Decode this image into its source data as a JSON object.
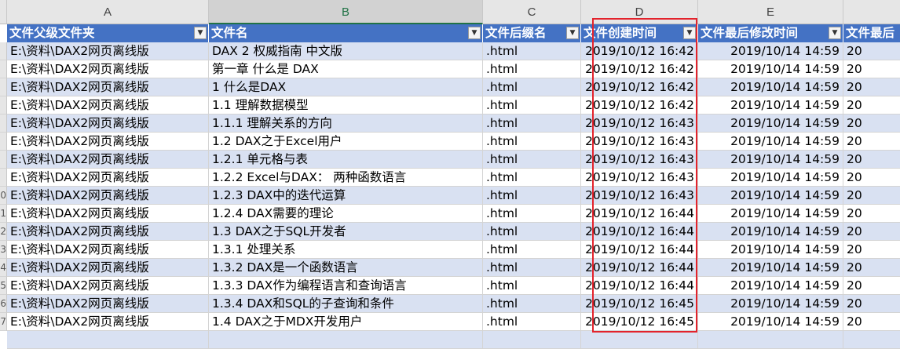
{
  "columns": [
    "A",
    "B",
    "C",
    "D",
    "E"
  ],
  "headers": [
    "文件父级文件夹",
    "文件名",
    "文件后缀名",
    "文件创建时间",
    "文件最后修改时间",
    "文件最后"
  ],
  "filter_icon": "chevron-down-icon",
  "rows": [
    {
      "n": "",
      "a": "E:\\资料\\DAX2网页离线版",
      "b": "DAX 2 权威指南 中文版",
      "c": ".html",
      "d": "2019/10/12 16:42",
      "e": "2019/10/14 14:59",
      "f": "20"
    },
    {
      "n": "",
      "a": "E:\\资料\\DAX2网页离线版",
      "b": "第一章 什么是 DAX",
      "c": ".html",
      "d": "2019/10/12 16:42",
      "e": "2019/10/14 14:59",
      "f": "20"
    },
    {
      "n": "",
      "a": "E:\\资料\\DAX2网页离线版",
      "b": "1 什么是DAX",
      "c": ".html",
      "d": "2019/10/12 16:42",
      "e": "2019/10/14 14:59",
      "f": "20"
    },
    {
      "n": "",
      "a": "E:\\资料\\DAX2网页离线版",
      "b": "1.1 理解数据模型",
      "c": ".html",
      "d": "2019/10/12 16:42",
      "e": "2019/10/14 14:59",
      "f": "20"
    },
    {
      "n": "",
      "a": "E:\\资料\\DAX2网页离线版",
      "b": "1.1.1 理解关系的方向",
      "c": ".html",
      "d": "2019/10/12 16:43",
      "e": "2019/10/14 14:59",
      "f": "20"
    },
    {
      "n": "",
      "a": "E:\\资料\\DAX2网页离线版",
      "b": "1.2 DAX之于Excel用户",
      "c": ".html",
      "d": "2019/10/12 16:43",
      "e": "2019/10/14 14:59",
      "f": "20"
    },
    {
      "n": "",
      "a": "E:\\资料\\DAX2网页离线版",
      "b": "1.2.1 单元格与表",
      "c": ".html",
      "d": "2019/10/12 16:43",
      "e": "2019/10/14 14:59",
      "f": "20"
    },
    {
      "n": "",
      "a": "E:\\资料\\DAX2网页离线版",
      "b": "1.2.2 Excel与DAX： 两种函数语言",
      "c": ".html",
      "d": "2019/10/12 16:43",
      "e": "2019/10/14 14:59",
      "f": "20"
    },
    {
      "n": "0",
      "a": "E:\\资料\\DAX2网页离线版",
      "b": "1.2.3 DAX中的迭代运算",
      "c": ".html",
      "d": "2019/10/12 16:43",
      "e": "2019/10/14 14:59",
      "f": "20"
    },
    {
      "n": "1",
      "a": "E:\\资料\\DAX2网页离线版",
      "b": "1.2.4 DAX需要的理论",
      "c": ".html",
      "d": "2019/10/12 16:44",
      "e": "2019/10/14 14:59",
      "f": "20"
    },
    {
      "n": "2",
      "a": "E:\\资料\\DAX2网页离线版",
      "b": "1.3 DAX之于SQL开发者",
      "c": ".html",
      "d": "2019/10/12 16:44",
      "e": "2019/10/14 14:59",
      "f": "20"
    },
    {
      "n": "3",
      "a": "E:\\资料\\DAX2网页离线版",
      "b": "1.3.1 处理关系",
      "c": ".html",
      "d": "2019/10/12 16:44",
      "e": "2019/10/14 14:59",
      "f": "20"
    },
    {
      "n": "4",
      "a": "E:\\资料\\DAX2网页离线版",
      "b": "1.3.2 DAX是一个函数语言",
      "c": ".html",
      "d": "2019/10/12 16:44",
      "e": "2019/10/14 14:59",
      "f": "20"
    },
    {
      "n": "5",
      "a": "E:\\资料\\DAX2网页离线版",
      "b": "1.3.3 DAX作为编程语言和查询语言",
      "c": ".html",
      "d": "2019/10/12 16:44",
      "e": "2019/10/14 14:59",
      "f": "20"
    },
    {
      "n": "6",
      "a": "E:\\资料\\DAX2网页离线版",
      "b": "1.3.4 DAX和SQL的子查询和条件",
      "c": ".html",
      "d": "2019/10/12 16:45",
      "e": "2019/10/14 14:59",
      "f": "20"
    },
    {
      "n": "7",
      "a": "E:\\资料\\DAX2网页离线版",
      "b": "1.4 DAX之于MDX开发用户",
      "c": ".html",
      "d": "2019/10/12 16:45",
      "e": "2019/10/14 14:59",
      "f": "20"
    }
  ],
  "colors": {
    "header_fill": "#4472c4",
    "band_fill": "#d9e1f2",
    "highlight_border": "#e3232c",
    "active_column": "#217346"
  }
}
